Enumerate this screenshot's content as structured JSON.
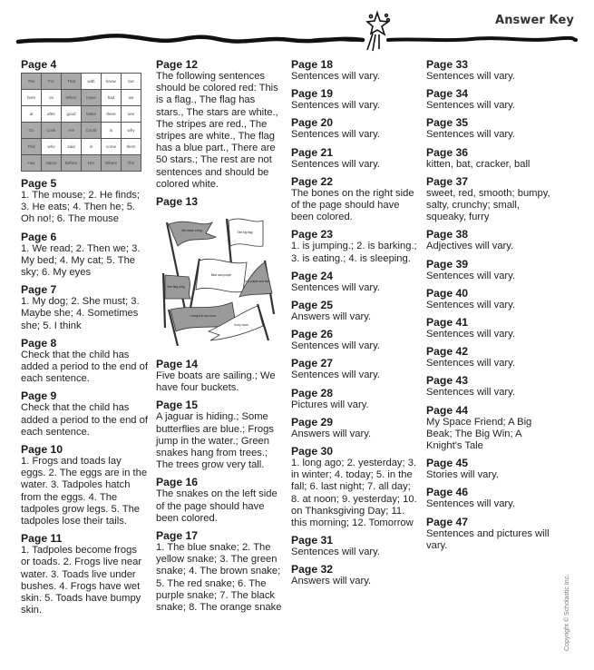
{
  "header": {
    "title": "Answer Key",
    "decoration_icon": "shooting-star-icon"
  },
  "page4": {
    "heading": "Page 4",
    "grid": [
      [
        {
          "w": "The",
          "shaded": true
        },
        {
          "w": "For",
          "shaded": true
        },
        {
          "w": "That",
          "shaded": true
        },
        {
          "w": "with",
          "shaded": false
        },
        {
          "w": "know",
          "shaded": false
        },
        {
          "w": "but",
          "shaded": false
        }
      ],
      [
        {
          "w": "here",
          "shaded": false
        },
        {
          "w": "on",
          "shaded": false
        },
        {
          "w": "When",
          "shaded": true
        },
        {
          "w": "Have",
          "shaded": true
        },
        {
          "w": "had",
          "shaded": false
        },
        {
          "w": "we",
          "shaded": false
        }
      ],
      [
        {
          "w": "at",
          "shaded": false
        },
        {
          "w": "after",
          "shaded": false
        },
        {
          "w": "good",
          "shaded": false
        },
        {
          "w": "Make",
          "shaded": true
        },
        {
          "w": "there",
          "shaded": false
        },
        {
          "w": "see",
          "shaded": false
        }
      ],
      [
        {
          "w": "Go",
          "shaded": true
        },
        {
          "w": "Look",
          "shaded": true
        },
        {
          "w": "Are",
          "shaded": true
        },
        {
          "w": "Could",
          "shaded": true
        },
        {
          "w": "is",
          "shaded": false
        },
        {
          "w": "why",
          "shaded": false
        }
      ],
      [
        {
          "w": "This",
          "shaded": true
        },
        {
          "w": "who",
          "shaded": false
        },
        {
          "w": "said",
          "shaded": false
        },
        {
          "w": "in",
          "shaded": false
        },
        {
          "w": "come",
          "shaded": false
        },
        {
          "w": "them",
          "shaded": false
        }
      ],
      [
        {
          "w": "Has",
          "shaded": true
        },
        {
          "w": "Name",
          "shaded": true
        },
        {
          "w": "Before",
          "shaded": true
        },
        {
          "w": "Her",
          "shaded": true
        },
        {
          "w": "Where",
          "shaded": true
        },
        {
          "w": "The",
          "shaded": true
        }
      ]
    ]
  },
  "columns": [
    [
      {
        "heading": "Page 5",
        "text": "1. The mouse; 2. He finds; 3. He eats; 4. Then he; 5. Oh no!; 6. The mouse"
      },
      {
        "heading": "Page 6",
        "text": "1. We read; 2. Then we; 3. My bed; 4. My cat; 5. The sky; 6. My eyes"
      },
      {
        "heading": "Page 7",
        "text": "1. My dog; 2. She must; 3. Maybe she; 4. Sometimes she; 5. I think"
      },
      {
        "heading": "Page 8",
        "text": "Check that the child has added a period to the end of each sentence."
      },
      {
        "heading": "Page 9",
        "text": "Check that the child has added a period to the end of each sentence."
      },
      {
        "heading": "Page 10",
        "text": "1. Frogs and toads lay eggs. 2. The eggs are in the water. 3. Tadpoles hatch from the eggs. 4. The tadpoles grow legs. 5. The tadpoles lose their tails."
      },
      {
        "heading": "Page 11",
        "text": "1. Tadpoles become frogs or toads. 2. Frogs live near water. 3. Toads live under bushes. 4. Frogs have wet skin. 5. Toads have bumpy skin."
      }
    ],
    [
      {
        "heading": "Page 12",
        "text": "The following sentences should be colored red: This is a flag., The flag has stars., The stars are white., The stripes are red., The stripes are white., The flag has a blue part., There are 50 stars.; The rest are not sentences and should be colored white."
      },
      {
        "heading": "Page 13",
        "text": ""
      },
      {
        "heading": "Page 14",
        "text": "Five boats are sailing.; We have four buckets."
      },
      {
        "heading": "Page 15",
        "text": "A jaguar is hiding.; Some butterflies are blue.; Frogs jump in the water.; Green snakes hang from trees.; The trees grow very tall."
      },
      {
        "heading": "Page 16",
        "text": "The snakes on the left side of the page should have been colored."
      },
      {
        "heading": "Page 17",
        "text": "1. The blue snake; 2. The yellow snake; 3. The green snake; 4. The brown snake; 5. The red snake; 6. The purple snake; 7. The black snake; 8. The orange snake"
      }
    ],
    [
      {
        "heading": "Page 18",
        "text": "Sentences will vary."
      },
      {
        "heading": "Page 19",
        "text": "Sentences will vary."
      },
      {
        "heading": "Page 20",
        "text": "Sentences will vary."
      },
      {
        "heading": "Page 21",
        "text": "Sentences will vary."
      },
      {
        "heading": "Page 22",
        "text": "The bones on the right side of the page should have been colored."
      },
      {
        "heading": "Page 23",
        "text": "1. is jumping.; 2. is barking.; 3. is eating.; 4. is sleeping."
      },
      {
        "heading": "Page 24",
        "text": "Sentences will vary."
      },
      {
        "heading": "Page 25",
        "text": "Answers will vary."
      },
      {
        "heading": "Page 26",
        "text": "Sentences will vary."
      },
      {
        "heading": "Page 27",
        "text": "Sentences will vary."
      },
      {
        "heading": "Page 28",
        "text": "Pictures will vary."
      },
      {
        "heading": "Page 29",
        "text": "Answers will vary."
      },
      {
        "heading": "Page 30",
        "text": "1. long ago; 2. yesterday; 3. in winter; 4. today; 5. in the fall; 6. last night; 7. all day; 8. at noon; 9. yesterday; 10. on Thanksgiving Day; 11. this morning; 12. Tomorrow"
      },
      {
        "heading": "Page 31",
        "text": "Sentences will vary."
      },
      {
        "heading": "Page 32",
        "text": "Answers will vary."
      }
    ],
    [
      {
        "heading": "Page 33",
        "text": "Sentences will vary."
      },
      {
        "heading": "Page 34",
        "text": "Sentences will vary."
      },
      {
        "heading": "Page 35",
        "text": "Sentences will vary."
      },
      {
        "heading": "Page 36",
        "text": "kitten, bat, cracker, ball"
      },
      {
        "heading": "Page 37",
        "text": "sweet, red, smooth; bumpy, salty, crunchy; small, squeaky, furry"
      },
      {
        "heading": "Page 38",
        "text": "Adjectives will vary."
      },
      {
        "heading": "Page 39",
        "text": "Sentences will vary."
      },
      {
        "heading": "Page 40",
        "text": "Sentences will vary."
      },
      {
        "heading": "Page 41",
        "text": "Sentences will vary."
      },
      {
        "heading": "Page 42",
        "text": "Sentences will vary."
      },
      {
        "heading": "Page 43",
        "text": "Sentences will vary."
      },
      {
        "heading": "Page 44",
        "text": "My Space Friend; A Big Beak; The Big Win; A Knight's Tale"
      },
      {
        "heading": "Page 45",
        "text": "Stories will vary."
      },
      {
        "heading": "Page 46",
        "text": "Sentences will vary."
      },
      {
        "heading": "Page 47",
        "text": "Sentences and pictures will vary."
      }
    ]
  ],
  "page13_image": {
    "icon": "flags-illustration",
    "flag_labels": [
      "We made a flag.",
      "See big flag",
      "Blue and purple",
      "See flag a big",
      "It is purple and blue",
      "I hang it in my room.",
      "In my room"
    ],
    "shaded": [
      true,
      false,
      false,
      true,
      true,
      true,
      false
    ]
  },
  "copyright": "Copyright © Scholastic Inc."
}
